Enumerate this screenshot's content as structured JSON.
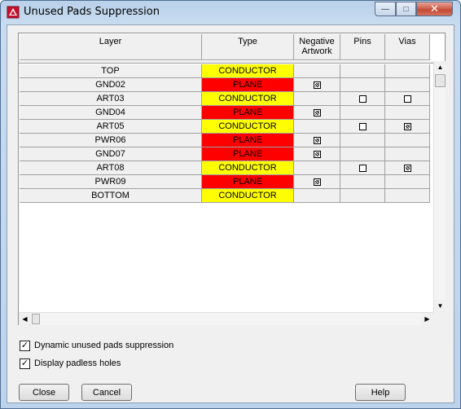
{
  "window": {
    "title": "Unused Pads Suppression",
    "close_glyph": "✕",
    "min_glyph": "—",
    "max_glyph": "□"
  },
  "grid": {
    "columns": {
      "layer": "Layer",
      "type": "Type",
      "negative_artwork": "Negative\nArtwork",
      "pins": "Pins",
      "vias": "Vias"
    },
    "rows": [
      {
        "layer": "TOP",
        "type": "CONDUCTOR",
        "negative": null,
        "pins": null,
        "vias": null
      },
      {
        "layer": "GND02",
        "type": "PLANE",
        "negative": true,
        "pins": null,
        "vias": null
      },
      {
        "layer": "ART03",
        "type": "CONDUCTOR",
        "negative": null,
        "pins": false,
        "vias": false
      },
      {
        "layer": "GND04",
        "type": "PLANE",
        "negative": true,
        "pins": null,
        "vias": null
      },
      {
        "layer": "ART05",
        "type": "CONDUCTOR",
        "negative": null,
        "pins": false,
        "vias": true
      },
      {
        "layer": "PWR06",
        "type": "PLANE",
        "negative": true,
        "pins": null,
        "vias": null
      },
      {
        "layer": "GND07",
        "type": "PLANE",
        "negative": true,
        "pins": null,
        "vias": null
      },
      {
        "layer": "ART08",
        "type": "CONDUCTOR",
        "negative": null,
        "pins": false,
        "vias": true
      },
      {
        "layer": "PWR09",
        "type": "PLANE",
        "negative": true,
        "pins": null,
        "vias": null
      },
      {
        "layer": "BOTTOM",
        "type": "CONDUCTOR",
        "negative": null,
        "pins": null,
        "vias": null
      }
    ],
    "colors": {
      "conductor": "#ffff00",
      "plane": "#ff0000"
    }
  },
  "options": {
    "dynamic_label": "Dynamic unused pads suppression",
    "dynamic_checked": true,
    "padless_label": "Display padless holes",
    "padless_checked": true
  },
  "buttons": {
    "close": "Close",
    "cancel": "Cancel",
    "help": "Help"
  }
}
